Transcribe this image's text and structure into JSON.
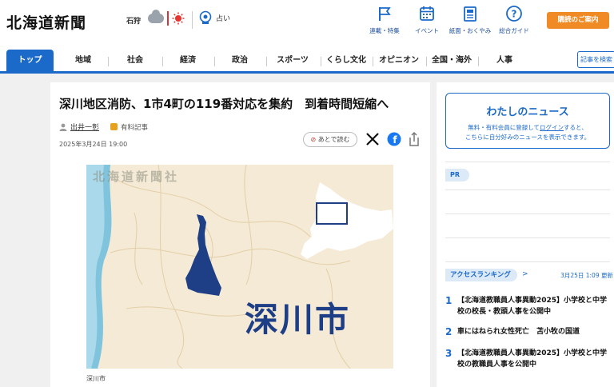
{
  "header": {
    "logo": "北海道新聞",
    "region": "石狩",
    "fortune_label": "占い",
    "nav": [
      {
        "label": "連載・特集",
        "icon": "flag-icon"
      },
      {
        "label": "イベント",
        "icon": "calendar-icon"
      },
      {
        "label": "紙面・おくやみ",
        "icon": "newspaper-icon"
      },
      {
        "label": "総合ガイド",
        "icon": "help-icon"
      }
    ],
    "guide_button": "購読のご案内"
  },
  "tabs": [
    "トップ",
    "地域",
    "社会",
    "経済",
    "政治",
    "スポーツ",
    "くらし文化",
    "オピニオン",
    "全国・海外",
    "人事"
  ],
  "search_button": "記事を検索",
  "article": {
    "headline": "深川地区消防、1市4町の119番対応を集約　到着時間短縮へ",
    "author": "出井一彰",
    "paid_label": "有料記事",
    "date": "2025年3月24日 19:00",
    "read_later": "あとで読む",
    "map_watermark": "北海道新聞社",
    "map_label": "深川市",
    "caption": "深川市"
  },
  "sidebar": {
    "mynews_title": "わたしのニュース",
    "mynews_text_1": "無料・有料会員に登録して",
    "mynews_login": "ログイン",
    "mynews_text_2": "すると、",
    "mynews_text_3": "こちらに自分好みのニュースを表示できます。",
    "pr": "PR",
    "ranking_title": "アクセスランキング",
    "ranking_time": "3月25日 1:09 更新",
    "ranking": [
      {
        "num": "1",
        "title": "【北海道教職員人事異動2025】小学校と中学校の校長・教頭人事を公開中"
      },
      {
        "num": "2",
        "title": "車にはねられ女性死亡　苫小牧の国道"
      },
      {
        "num": "3",
        "title": "【北海道教職員人事異動2025】小学校と中学校の教職員人事を公開中"
      }
    ]
  },
  "colors": {
    "brand": "#1b6ac9",
    "accent": "#f08a24",
    "map_region": "#1e3f86"
  }
}
